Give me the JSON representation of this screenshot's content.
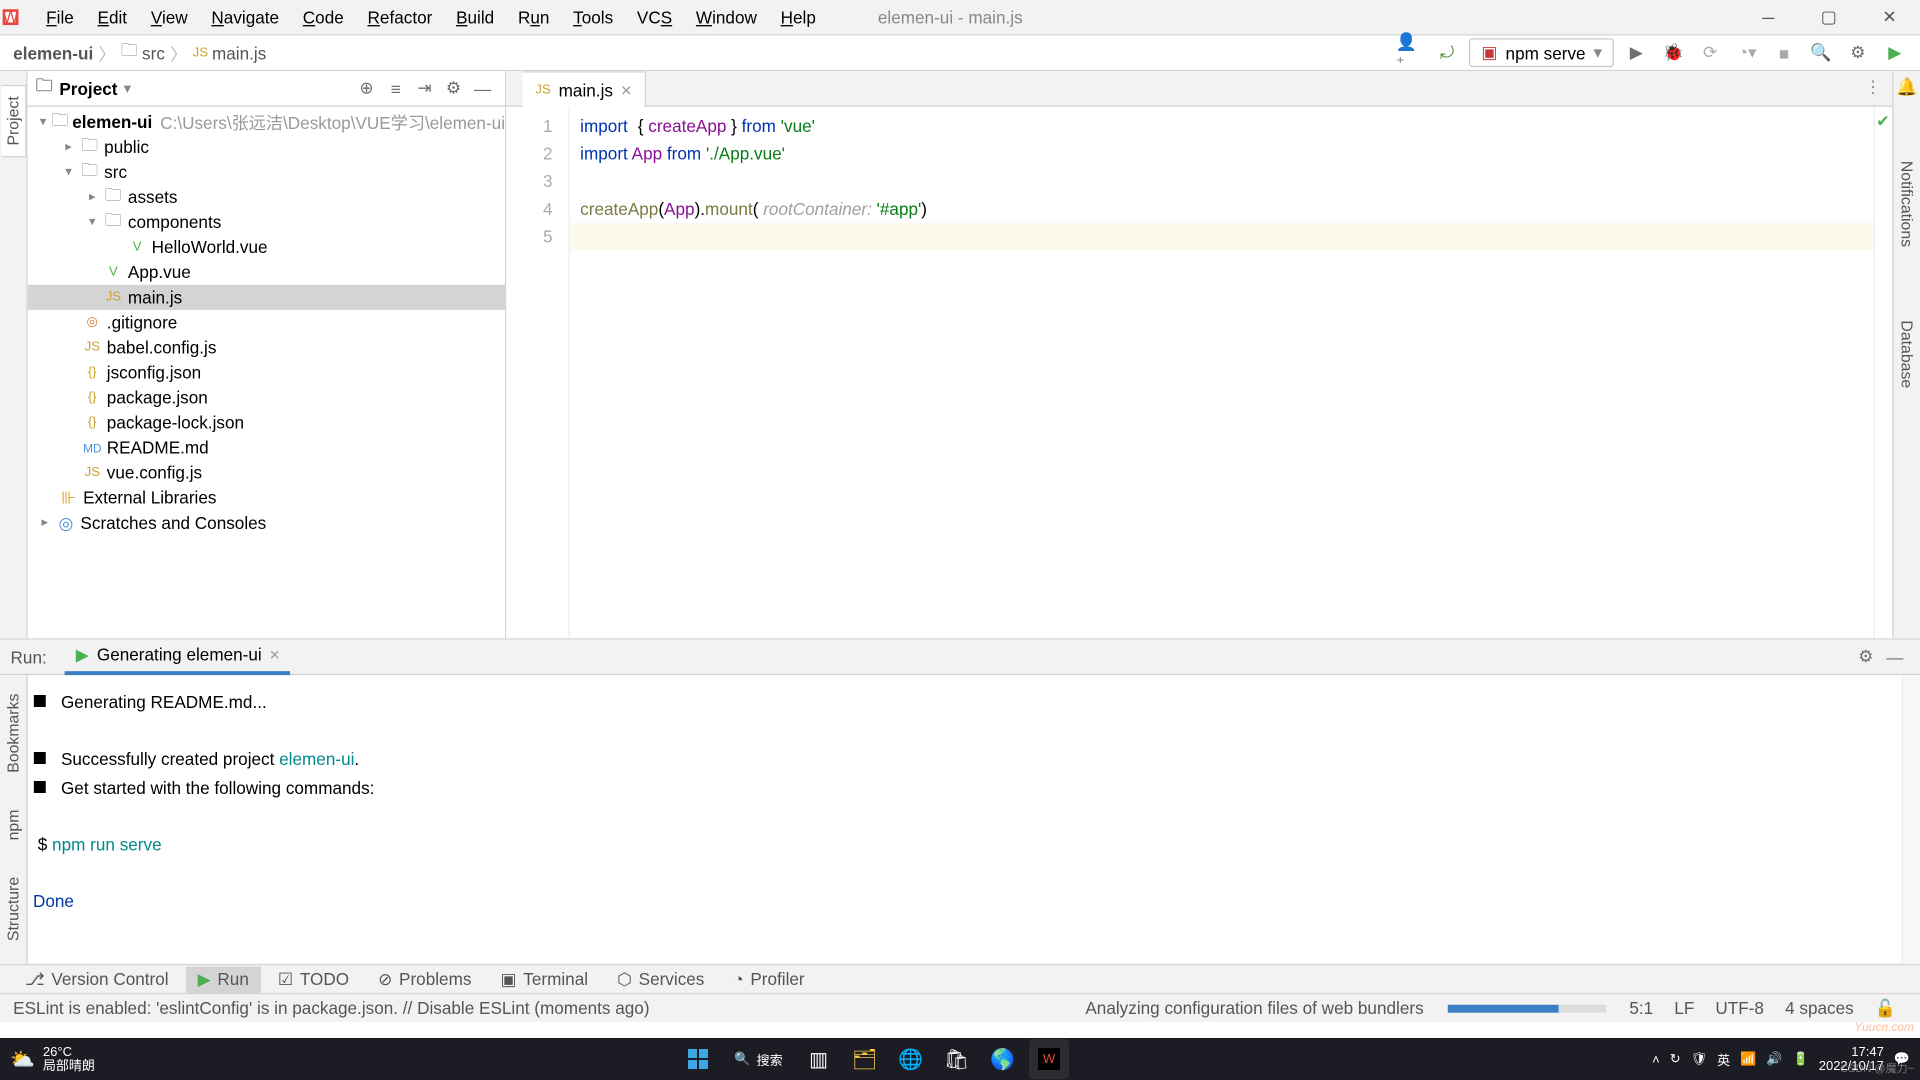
{
  "window": {
    "title": "elemen-ui - main.js"
  },
  "menus": [
    "File",
    "Edit",
    "View",
    "Navigate",
    "Code",
    "Refactor",
    "Build",
    "Run",
    "Tools",
    "VCS",
    "Window",
    "Help"
  ],
  "breadcrumb": [
    "elemen-ui",
    "src",
    "main.js"
  ],
  "runConfig": "npm serve",
  "projectPanel": {
    "title": "Project"
  },
  "projectRoot": {
    "name": "elemen-ui",
    "path": "C:\\Users\\张远洁\\Desktop\\VUE学习\\elemen-ui"
  },
  "tree": {
    "public": "public",
    "src": "src",
    "assets": "assets",
    "components": "components",
    "helloworld": "HelloWorld.vue",
    "appvue": "App.vue",
    "mainjs": "main.js",
    "gitignore": ".gitignore",
    "babel": "babel.config.js",
    "jsconfig": "jsconfig.json",
    "package": "package.json",
    "lock": "package-lock.json",
    "readme": "README.md",
    "vueconfig": "vue.config.js",
    "extlib": "External Libraries",
    "scratches": "Scratches and Consoles"
  },
  "editor": {
    "tab": "main.js",
    "lines": [
      "1",
      "2",
      "3",
      "4",
      "5"
    ],
    "l1": {
      "import": "import",
      "brace_open": "{ ",
      "createApp": "createApp",
      "brace_close": " }",
      "from": " from ",
      "vue": "'vue'"
    },
    "l2": {
      "import": "import",
      "app": " App ",
      "from": "from ",
      "path": "'./App.vue'"
    },
    "l4": {
      "createApp": "createApp",
      "open": "(",
      "App": "App",
      "close": ").",
      "mount": "mount",
      "open2": "( ",
      "hint": "rootContainer:",
      "str": " '#app'",
      "close2": ")"
    }
  },
  "runPanel": {
    "label": "Run:",
    "task": "Generating elemen-ui",
    "out": {
      "l1": "⯀   Generating README.md...",
      "l2a": "⯀   Successfully created project ",
      "l2b": "elemen-ui",
      "l2c": ".",
      "l3": "⯀   Get started with the following commands:",
      "l4a": " $ ",
      "l4b": "npm run serve",
      "done": "Done"
    }
  },
  "bottomTools": {
    "vc": "Version Control",
    "run": "Run",
    "todo": "TODO",
    "problems": "Problems",
    "terminal": "Terminal",
    "services": "Services",
    "profiler": "Profiler"
  },
  "status": {
    "msg": "ESLint is enabled: 'eslintConfig' is in package.json. // Disable ESLint (moments ago)",
    "analyzing": "Analyzing configuration files of web bundlers",
    "pos": "5:1",
    "lf": "LF",
    "enc": "UTF-8",
    "spaces": "4 spaces"
  },
  "leftTools": {
    "project": "Project",
    "bookmarks": "Bookmarks",
    "npm": "npm",
    "structure": "Structure"
  },
  "rightTools": {
    "notifications": "Notifications",
    "database": "Database"
  },
  "taskbar": {
    "temp": "26°C",
    "cond": "局部晴朗",
    "search": "搜索",
    "ime": "英",
    "time": "17:47",
    "date": "2022/10/17"
  },
  "watermark": "Yuucn.com"
}
